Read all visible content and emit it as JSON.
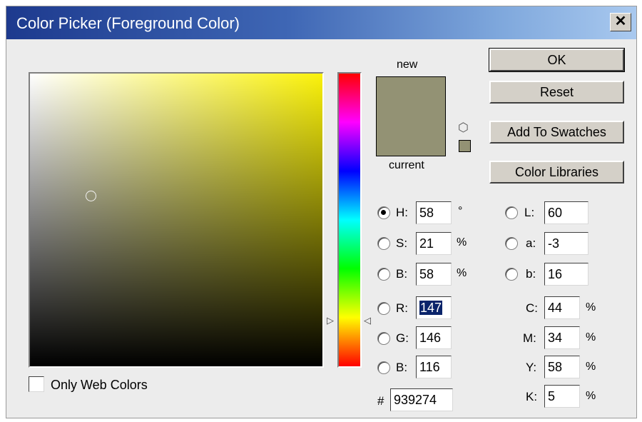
{
  "window": {
    "title": "Color Picker (Foreground Color)",
    "close_label": "✕"
  },
  "preview": {
    "new_label": "new",
    "current_label": "current",
    "new_color": "#939274",
    "current_color": "#939274",
    "gamut_icon": "cube-icon"
  },
  "field": {
    "hue_color": "#fbf20a",
    "saturation_pct": 21,
    "brightness_pct": 58
  },
  "hue_slider": {
    "position_pct": 84
  },
  "buttons": {
    "ok": "OK",
    "reset": "Reset",
    "add_to_swatches": "Add To Swatches",
    "color_libraries": "Color Libraries"
  },
  "hsb": {
    "h": {
      "label": "H:",
      "value": "58",
      "unit": "°",
      "selected": true
    },
    "s": {
      "label": "S:",
      "value": "21",
      "unit": "%",
      "selected": false
    },
    "b": {
      "label": "B:",
      "value": "58",
      "unit": "%",
      "selected": false
    }
  },
  "rgb": {
    "r": {
      "label": "R:",
      "value": "147",
      "selected": false
    },
    "g": {
      "label": "G:",
      "value": "146",
      "selected": false
    },
    "b": {
      "label": "B:",
      "value": "116",
      "selected": false
    }
  },
  "lab": {
    "l": {
      "label": "L:",
      "value": "60",
      "selected": false
    },
    "a": {
      "label": "a:",
      "value": "-3",
      "selected": false
    },
    "b": {
      "label": "b:",
      "value": "16",
      "selected": false
    }
  },
  "cmyk": {
    "c": {
      "label": "C:",
      "value": "44",
      "unit": "%"
    },
    "m": {
      "label": "M:",
      "value": "34",
      "unit": "%"
    },
    "y": {
      "label": "Y:",
      "value": "58",
      "unit": "%"
    },
    "k": {
      "label": "K:",
      "value": "5",
      "unit": "%"
    }
  },
  "hex": {
    "label": "#",
    "value": "939274"
  },
  "web_colors": {
    "label": "Only Web Colors",
    "checked": false
  }
}
